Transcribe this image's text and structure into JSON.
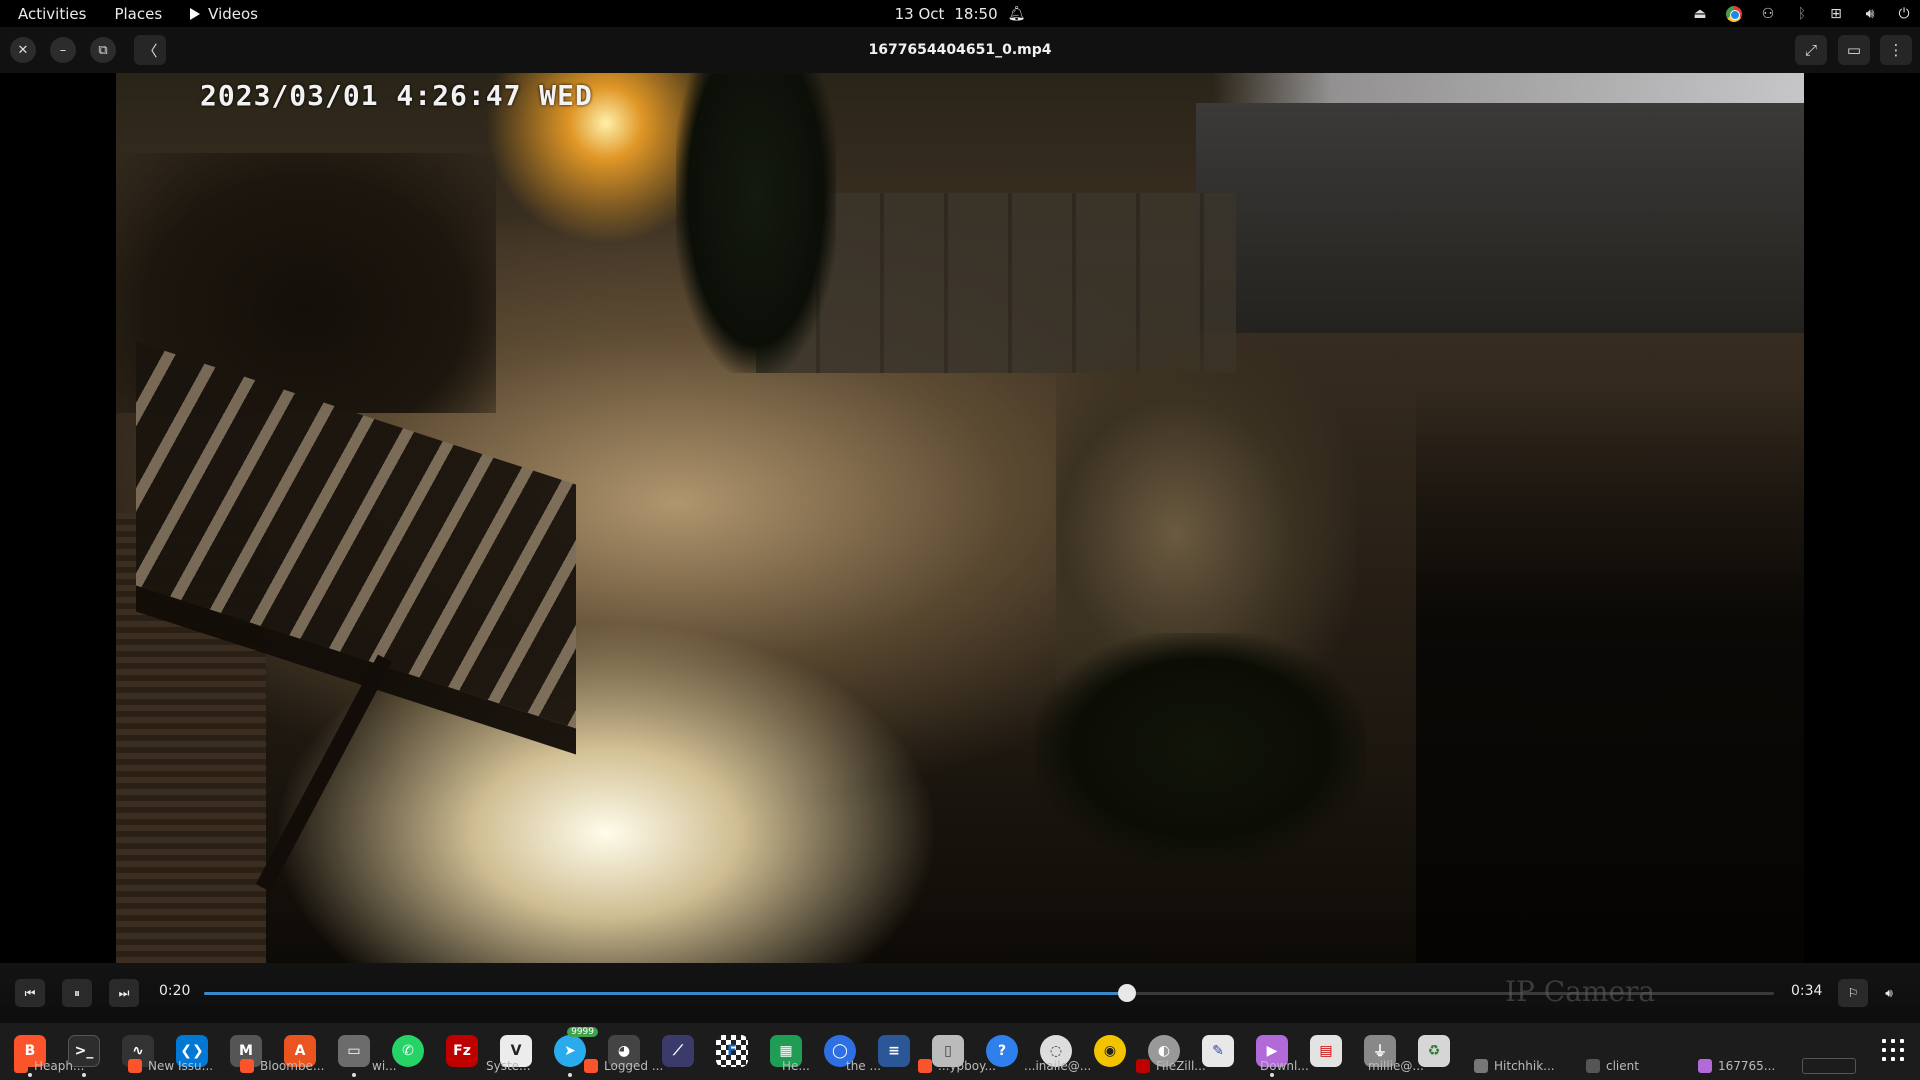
{
  "topbar": {
    "activities": "Activities",
    "places": "Places",
    "app_menu": "Videos",
    "date": "13 Oct",
    "time": "18:50"
  },
  "header": {
    "title": "1677654404651_0.mp4"
  },
  "video": {
    "osd_timestamp": "2023/03/01 4:26:47 WED",
    "osd_camera": "IP Camera"
  },
  "player": {
    "current_time": "0:20",
    "total_time": "0:34",
    "progress_fraction": 0.5882,
    "accent_color": "#3a89c9"
  },
  "dock": {
    "telegram_badge": "9999",
    "window_labels": [
      "Heaph...",
      "New Issu...",
      "Bloombe...",
      "wi...",
      "Syste...",
      "Logged ...",
      "He...",
      "the ...",
      "...ypboy...",
      "...inaile@...",
      "FileZill...",
      "Downl...",
      "millie@...",
      "Hitchhik...",
      "client",
      "167765..."
    ]
  }
}
